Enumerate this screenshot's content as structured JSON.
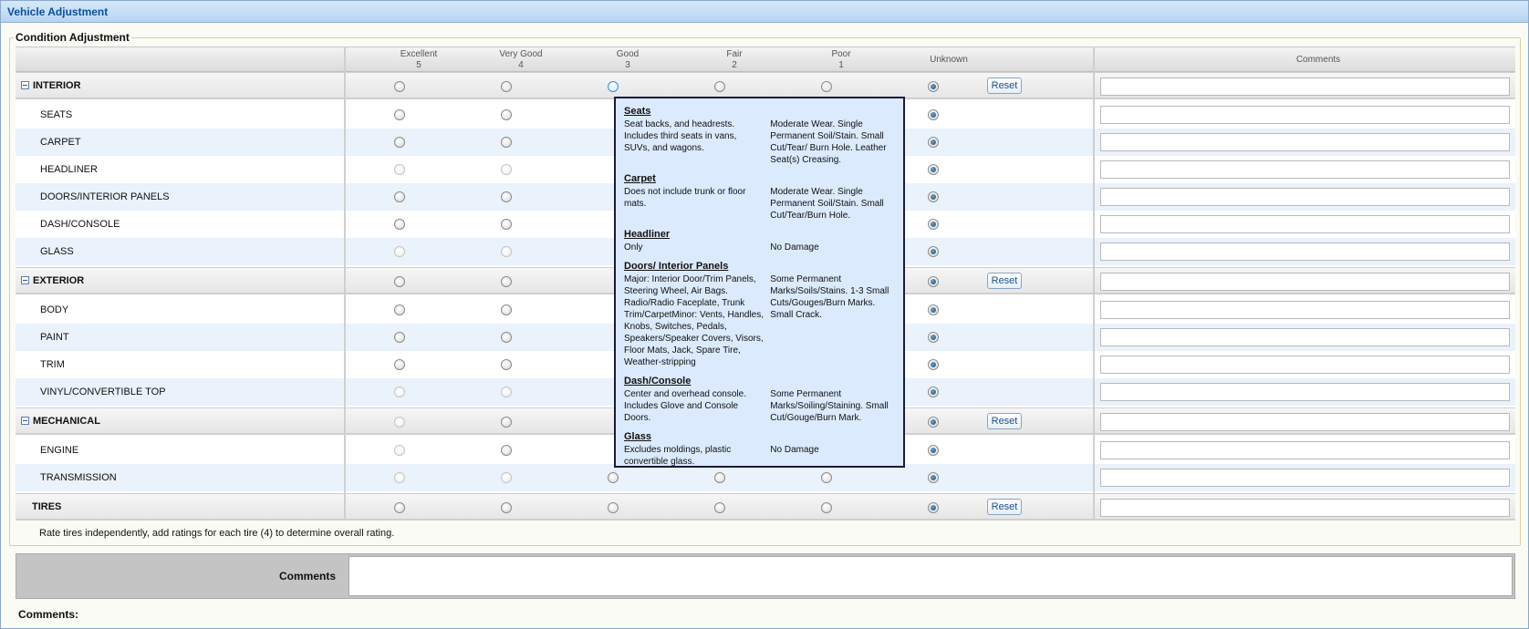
{
  "window": {
    "title": "Vehicle Adjustment"
  },
  "section_legend": "Condition Adjustment",
  "columns": [
    {
      "label": "Excellent",
      "value": "5"
    },
    {
      "label": "Very Good",
      "value": "4"
    },
    {
      "label": "Good",
      "value": "3"
    },
    {
      "label": "Fair",
      "value": "2"
    },
    {
      "label": "Poor",
      "value": "1"
    },
    {
      "label": "Unknown",
      "value": ""
    }
  ],
  "comments_header": "Comments",
  "reset_label": "Reset",
  "categories": {
    "interior": {
      "label": "INTERIOR",
      "items": [
        "SEATS",
        "CARPET",
        "HEADLINER",
        "DOORS/INTERIOR PANELS",
        "DASH/CONSOLE",
        "GLASS"
      ]
    },
    "exterior": {
      "label": "EXTERIOR",
      "items": [
        "BODY",
        "PAINT",
        "TRIM",
        "VINYL/CONVERTIBLE TOP"
      ]
    },
    "mechanical": {
      "label": "MECHANICAL",
      "items": [
        "ENGINE",
        "TRANSMISSION"
      ]
    },
    "tires": {
      "label": "TIRES"
    }
  },
  "tires_note": "Rate tires independently, add ratings for each tire (4) to determine overall rating.",
  "comments_block_label": "Comments",
  "footer_comments_label": "Comments:",
  "tooltip": {
    "sections": [
      {
        "title": "Seats",
        "left": "Seat backs, and headrests. Includes third seats in vans, SUVs, and wagons.",
        "right": "Moderate Wear. Single Permanent Soil/Stain. Small Cut/Tear/ Burn Hole. Leather Seat(s) Creasing."
      },
      {
        "title": "Carpet",
        "left": "Does not include trunk or floor mats.",
        "right": "Moderate Wear. Single Permanent Soil/Stain. Small Cut/Tear/Burn Hole."
      },
      {
        "title": "Headliner",
        "left": "Only",
        "right": "No Damage"
      },
      {
        "title": "Doors/ Interior Panels",
        "left": "Major: Interior Door/Trim Panels, Steering Wheel, Air Bags. Radio/Radio Faceplate, Trunk Trim/CarpetMinor: Vents, Handles, Knobs, Switches, Pedals, Speakers/Speaker Covers, Visors, Floor Mats, Jack, Spare Tire, Weather-stripping",
        "right": "Some Permanent Marks/Soils/Stains. 1-3 Small Cuts/Gouges/Burn Marks. Small Crack."
      },
      {
        "title": "Dash/Console",
        "left": "Center and overhead console. Includes Glove and Console Doors.",
        "right": "Some Permanent Marks/Soiling/Staining. Small Cut/Gouge/Burn Mark."
      },
      {
        "title": "Glass",
        "left": "Excludes moldings, plastic convertible glass.",
        "right": "No Damage"
      }
    ]
  }
}
